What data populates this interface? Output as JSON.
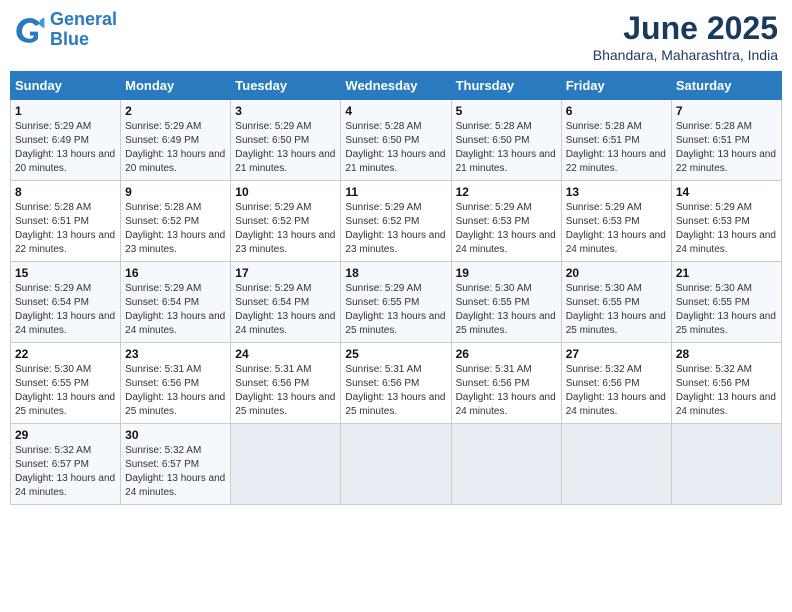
{
  "logo": {
    "line1": "General",
    "line2": "Blue"
  },
  "title": "June 2025",
  "location": "Bhandara, Maharashtra, India",
  "weekdays": [
    "Sunday",
    "Monday",
    "Tuesday",
    "Wednesday",
    "Thursday",
    "Friday",
    "Saturday"
  ],
  "weeks": [
    [
      {
        "day": "1",
        "sunrise": "5:29 AM",
        "sunset": "6:49 PM",
        "daylight": "13 hours and 20 minutes."
      },
      {
        "day": "2",
        "sunrise": "5:29 AM",
        "sunset": "6:49 PM",
        "daylight": "13 hours and 20 minutes."
      },
      {
        "day": "3",
        "sunrise": "5:29 AM",
        "sunset": "6:50 PM",
        "daylight": "13 hours and 21 minutes."
      },
      {
        "day": "4",
        "sunrise": "5:28 AM",
        "sunset": "6:50 PM",
        "daylight": "13 hours and 21 minutes."
      },
      {
        "day": "5",
        "sunrise": "5:28 AM",
        "sunset": "6:50 PM",
        "daylight": "13 hours and 21 minutes."
      },
      {
        "day": "6",
        "sunrise": "5:28 AM",
        "sunset": "6:51 PM",
        "daylight": "13 hours and 22 minutes."
      },
      {
        "day": "7",
        "sunrise": "5:28 AM",
        "sunset": "6:51 PM",
        "daylight": "13 hours and 22 minutes."
      }
    ],
    [
      {
        "day": "8",
        "sunrise": "5:28 AM",
        "sunset": "6:51 PM",
        "daylight": "13 hours and 22 minutes."
      },
      {
        "day": "9",
        "sunrise": "5:28 AM",
        "sunset": "6:52 PM",
        "daylight": "13 hours and 23 minutes."
      },
      {
        "day": "10",
        "sunrise": "5:29 AM",
        "sunset": "6:52 PM",
        "daylight": "13 hours and 23 minutes."
      },
      {
        "day": "11",
        "sunrise": "5:29 AM",
        "sunset": "6:52 PM",
        "daylight": "13 hours and 23 minutes."
      },
      {
        "day": "12",
        "sunrise": "5:29 AM",
        "sunset": "6:53 PM",
        "daylight": "13 hours and 24 minutes."
      },
      {
        "day": "13",
        "sunrise": "5:29 AM",
        "sunset": "6:53 PM",
        "daylight": "13 hours and 24 minutes."
      },
      {
        "day": "14",
        "sunrise": "5:29 AM",
        "sunset": "6:53 PM",
        "daylight": "13 hours and 24 minutes."
      }
    ],
    [
      {
        "day": "15",
        "sunrise": "5:29 AM",
        "sunset": "6:54 PM",
        "daylight": "13 hours and 24 minutes."
      },
      {
        "day": "16",
        "sunrise": "5:29 AM",
        "sunset": "6:54 PM",
        "daylight": "13 hours and 24 minutes."
      },
      {
        "day": "17",
        "sunrise": "5:29 AM",
        "sunset": "6:54 PM",
        "daylight": "13 hours and 24 minutes."
      },
      {
        "day": "18",
        "sunrise": "5:29 AM",
        "sunset": "6:55 PM",
        "daylight": "13 hours and 25 minutes."
      },
      {
        "day": "19",
        "sunrise": "5:30 AM",
        "sunset": "6:55 PM",
        "daylight": "13 hours and 25 minutes."
      },
      {
        "day": "20",
        "sunrise": "5:30 AM",
        "sunset": "6:55 PM",
        "daylight": "13 hours and 25 minutes."
      },
      {
        "day": "21",
        "sunrise": "5:30 AM",
        "sunset": "6:55 PM",
        "daylight": "13 hours and 25 minutes."
      }
    ],
    [
      {
        "day": "22",
        "sunrise": "5:30 AM",
        "sunset": "6:55 PM",
        "daylight": "13 hours and 25 minutes."
      },
      {
        "day": "23",
        "sunrise": "5:31 AM",
        "sunset": "6:56 PM",
        "daylight": "13 hours and 25 minutes."
      },
      {
        "day": "24",
        "sunrise": "5:31 AM",
        "sunset": "6:56 PM",
        "daylight": "13 hours and 25 minutes."
      },
      {
        "day": "25",
        "sunrise": "5:31 AM",
        "sunset": "6:56 PM",
        "daylight": "13 hours and 25 minutes."
      },
      {
        "day": "26",
        "sunrise": "5:31 AM",
        "sunset": "6:56 PM",
        "daylight": "13 hours and 24 minutes."
      },
      {
        "day": "27",
        "sunrise": "5:32 AM",
        "sunset": "6:56 PM",
        "daylight": "13 hours and 24 minutes."
      },
      {
        "day": "28",
        "sunrise": "5:32 AM",
        "sunset": "6:56 PM",
        "daylight": "13 hours and 24 minutes."
      }
    ],
    [
      {
        "day": "29",
        "sunrise": "5:32 AM",
        "sunset": "6:57 PM",
        "daylight": "13 hours and 24 minutes."
      },
      {
        "day": "30",
        "sunrise": "5:32 AM",
        "sunset": "6:57 PM",
        "daylight": "13 hours and 24 minutes."
      },
      null,
      null,
      null,
      null,
      null
    ]
  ]
}
